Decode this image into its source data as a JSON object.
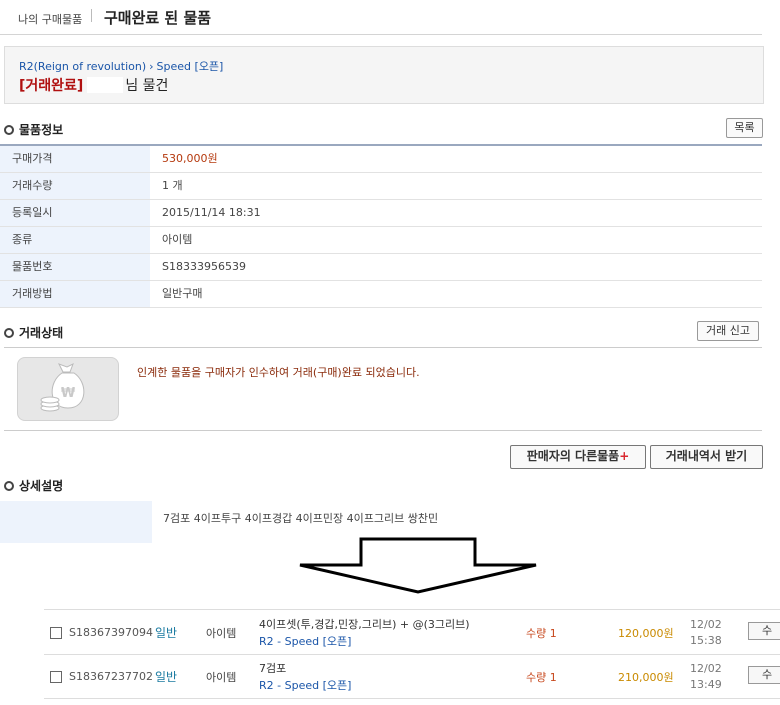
{
  "header": {
    "breadcrumb": "나의 구매물품",
    "title": "구매완료 된 물품"
  },
  "item_title": {
    "game": "R2(Reign of revolution)",
    "server": "Speed [오픈]",
    "status_tag": "[거래완료]",
    "title_rest": "님 물건"
  },
  "info": {
    "section_title": "물품정보",
    "list_button": "목록",
    "rows": [
      {
        "label": "구매가격",
        "value": "530,000원"
      },
      {
        "label": "거래수량",
        "value": "1 개"
      },
      {
        "label": "등록일시",
        "value": "2015/11/14 18:31"
      },
      {
        "label": "종류",
        "value": "아이템"
      },
      {
        "label": "물품번호",
        "value": "S18333956539"
      },
      {
        "label": "거래방법",
        "value": "일반구매"
      }
    ]
  },
  "status": {
    "section_title": "거래상태",
    "report_button": "거래 신고",
    "message": "인계한 물품을 구매자가 인수하여 거래(구매)완료 되었습니다."
  },
  "actions": {
    "seller_items": "판매자의 다른물품",
    "seller_items_plus": "+",
    "history": "거래내역서 받기"
  },
  "detail": {
    "section_title": "상세설명",
    "text": "7검포 4이프투구 4이프경갑 4이프민장 4이프그리브 쌍찬민"
  },
  "listing": [
    {
      "id": "S18367397094",
      "type": "일반",
      "category": "아이템",
      "name": "4이프셋(투,경갑,민장,그리브) + @(3그리브)",
      "server": "R2 - Speed [오픈]",
      "qty": "수량 1",
      "price": "120,000원",
      "date": "12/02",
      "time": "15:38",
      "btn": "수"
    },
    {
      "id": "S18367237702",
      "type": "일반",
      "category": "아이템",
      "name": "7검포",
      "server": "R2 - Speed [오픈]",
      "qty": "수량 1",
      "price": "210,000원",
      "date": "12/02",
      "time": "13:49",
      "btn": "수"
    }
  ],
  "colors": {
    "accent_red": "#b01010",
    "link_blue": "#1a55a8",
    "price": "#b5390e",
    "label_bg": "#edf3fc"
  },
  "icons": [
    "money-bag-icon",
    "coin-stack-icon",
    "down-arrow-icon"
  ]
}
